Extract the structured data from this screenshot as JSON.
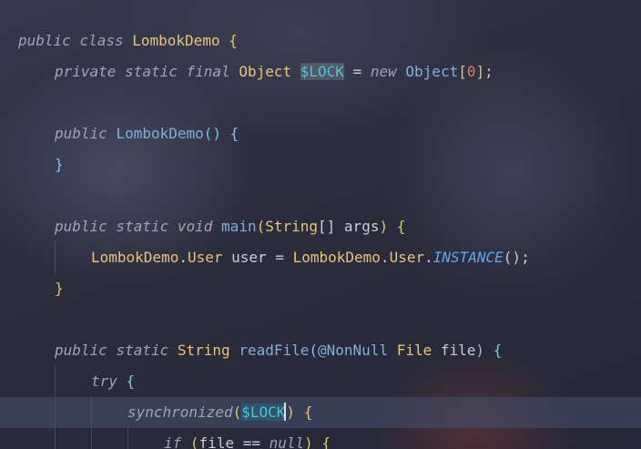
{
  "editor": {
    "language": "java",
    "lines": [
      {
        "tokens": [
          "public",
          "class",
          "LombokDemo",
          "{"
        ]
      },
      {
        "tokens": [
          "private",
          "static",
          "final",
          "Object",
          "$LOCK",
          "=",
          "new",
          "Object",
          "[",
          "0",
          "];"
        ]
      },
      {
        "tokens": []
      },
      {
        "tokens": [
          "public",
          "LombokDemo",
          "()",
          "{"
        ]
      },
      {
        "tokens": [
          "}"
        ]
      },
      {
        "tokens": []
      },
      {
        "tokens": [
          "public",
          "static",
          "void",
          "main",
          "(",
          "String",
          "[]",
          "args",
          ")",
          "{"
        ]
      },
      {
        "tokens": [
          "LombokDemo",
          ".",
          "User",
          "user",
          "=",
          "LombokDemo",
          ".",
          "User",
          ".",
          "INSTANCE",
          "();"
        ]
      },
      {
        "tokens": [
          "}"
        ]
      },
      {
        "tokens": []
      },
      {
        "tokens": [
          "public",
          "static",
          "String",
          "readFile",
          "(",
          "@NonNull",
          "File",
          "file",
          ")",
          "{"
        ]
      },
      {
        "tokens": [
          "try",
          "{"
        ]
      },
      {
        "tokens": [
          "synchronized",
          "(",
          "$LOCK",
          ")",
          "{"
        ]
      },
      {
        "tokens": [
          "if",
          "(",
          "file",
          "==",
          "null",
          ")",
          "{"
        ]
      }
    ],
    "current_line": 13,
    "highlighted_symbol": "$LOCK"
  },
  "colors": {
    "background": "#2a2c3c",
    "keyword": "#a0a3b8",
    "class": "#e8c27e",
    "method": "#56a8f5",
    "field": "#4fc1d0",
    "number": "#e07a5f"
  },
  "background_image": "anime-wallpaper"
}
